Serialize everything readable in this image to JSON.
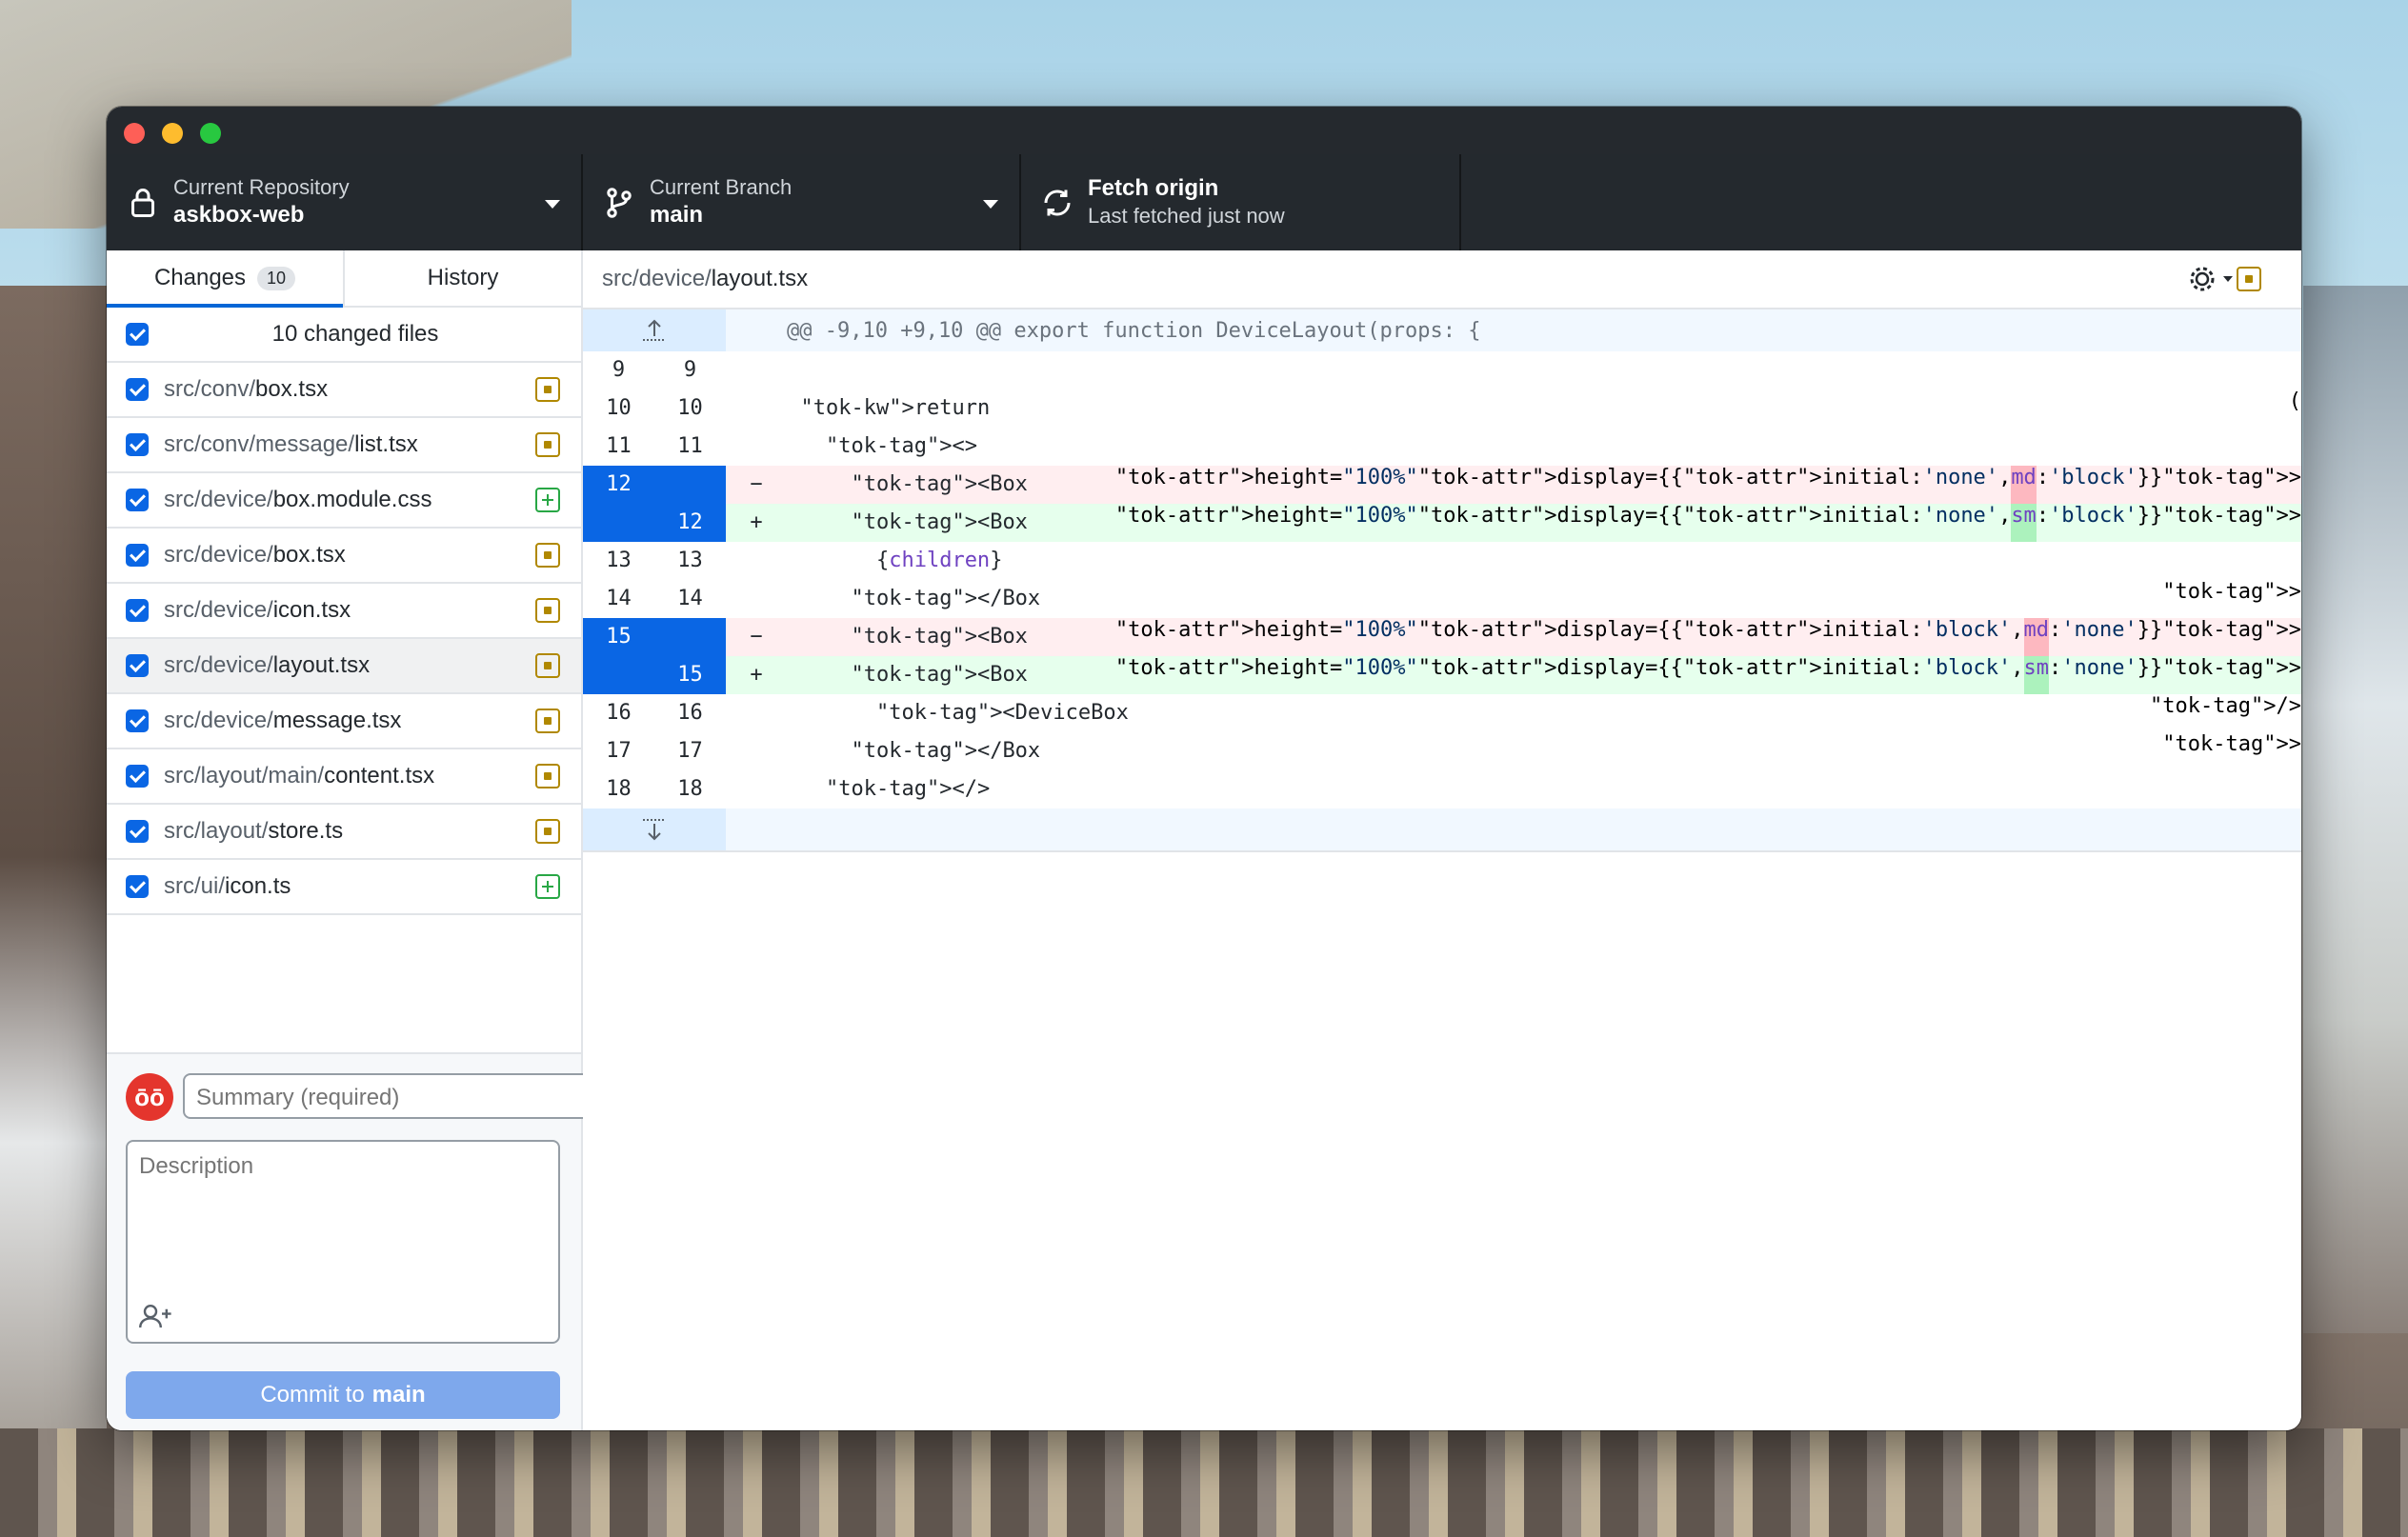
{
  "toolbar": {
    "repo_label": "Current Repository",
    "repo_value": "askbox-web",
    "branch_label": "Current Branch",
    "branch_value": "main",
    "fetch_label": "Fetch origin",
    "fetch_sub": "Last fetched just now"
  },
  "tabs": {
    "changes": "Changes",
    "changes_count": "10",
    "history": "History"
  },
  "files_header": "10 changed files",
  "files": [
    {
      "dir": "src/conv/",
      "name": "box.tsx",
      "status": "modified"
    },
    {
      "dir": "src/conv/message/",
      "name": "list.tsx",
      "status": "modified"
    },
    {
      "dir": "src/device/",
      "name": "box.module.css",
      "status": "added"
    },
    {
      "dir": "src/device/",
      "name": "box.tsx",
      "status": "modified"
    },
    {
      "dir": "src/device/",
      "name": "icon.tsx",
      "status": "modified"
    },
    {
      "dir": "src/device/",
      "name": "layout.tsx",
      "status": "modified"
    },
    {
      "dir": "src/device/",
      "name": "message.tsx",
      "status": "modified"
    },
    {
      "dir": "src/layout/main/",
      "name": "content.tsx",
      "status": "modified"
    },
    {
      "dir": "src/layout/",
      "name": "store.ts",
      "status": "modified"
    },
    {
      "dir": "src/ui/",
      "name": "icon.ts",
      "status": "added"
    }
  ],
  "commit": {
    "avatar": "ōō",
    "summary_placeholder": "Summary (required)",
    "description_placeholder": "Description",
    "button_prefix": "Commit to",
    "button_branch": "main"
  },
  "diff": {
    "path_dir": "src/device/",
    "path_name": "layout.tsx",
    "hunk_header": "@@ -9,10 +9,10 @@ export function DeviceLayout(props: {",
    "lines": [
      {
        "old": "9",
        "new": "9",
        "type": "ctx",
        "code": ""
      },
      {
        "old": "10",
        "new": "10",
        "type": "ctx",
        "code": "  return ("
      },
      {
        "old": "11",
        "new": "11",
        "type": "ctx",
        "code": "    <>"
      },
      {
        "old": "12",
        "new": "",
        "type": "del",
        "code": "      <Box height=\"100%\" display={{ initial: 'none', md: 'block' }}>"
      },
      {
        "old": "",
        "new": "12",
        "type": "add",
        "code": "      <Box height=\"100%\" display={{ initial: 'none', sm: 'block' }}>"
      },
      {
        "old": "13",
        "new": "13",
        "type": "ctx",
        "code": "        {children}"
      },
      {
        "old": "14",
        "new": "14",
        "type": "ctx",
        "code": "      </Box>"
      },
      {
        "old": "15",
        "new": "",
        "type": "del",
        "code": "      <Box height=\"100%\" display={{ initial: 'block', md: 'none' }}>"
      },
      {
        "old": "",
        "new": "15",
        "type": "add",
        "code": "      <Box height=\"100%\" display={{ initial: 'block', sm: 'none' }}>"
      },
      {
        "old": "16",
        "new": "16",
        "type": "ctx",
        "code": "        <DeviceBox />"
      },
      {
        "old": "17",
        "new": "17",
        "type": "ctx",
        "code": "      </Box>"
      },
      {
        "old": "18",
        "new": "18",
        "type": "ctx",
        "code": "    </>"
      }
    ]
  },
  "colors": {
    "selection": "#0a66e4",
    "deleted_bg": "#ffeef0",
    "added_bg": "#e6ffed",
    "modified_badge": "#b08800",
    "added_badge": "#28a745",
    "commit_button": "#7ea8ec"
  },
  "icons": [
    "lock-icon",
    "branch-icon",
    "sync-icon",
    "caret-down-icon",
    "gear-icon",
    "expand-up-icon",
    "expand-down-icon",
    "add-coauthor-icon"
  ]
}
